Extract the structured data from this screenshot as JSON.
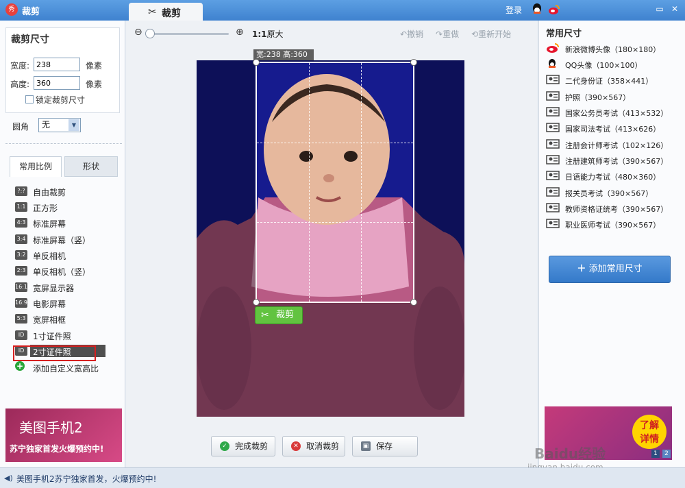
{
  "titlebar": {
    "app_title": "裁剪",
    "tab_label": "裁剪",
    "login": "登录",
    "min": "▭",
    "close": "✕"
  },
  "left": {
    "size_title": "裁剪尺寸",
    "width_label": "宽度:",
    "width_value": "238",
    "height_label": "高度:",
    "height_value": "360",
    "unit": "像素",
    "lock_label": "锁定裁剪尺寸",
    "corner_label": "圆角",
    "corner_value": "无",
    "tabs": [
      "常用比例",
      "形状"
    ],
    "ratios": [
      {
        "badge": "?:?",
        "label": "自由裁剪"
      },
      {
        "badge": "1:1",
        "label": "正方形"
      },
      {
        "badge": "4:3",
        "label": "标准屏幕"
      },
      {
        "badge": "3:4",
        "label": "标准屏幕（竖）"
      },
      {
        "badge": "3:2",
        "label": "单反相机"
      },
      {
        "badge": "2:3",
        "label": "单反相机（竖）"
      },
      {
        "badge": "16:10",
        "label": "宽屏显示器"
      },
      {
        "badge": "16:9",
        "label": "电影屏幕"
      },
      {
        "badge": "5:3",
        "label": "宽屏相框"
      },
      {
        "badge": "ID",
        "label": "1寸证件照"
      },
      {
        "badge": "ID",
        "label": "2寸证件照"
      }
    ],
    "add_ratio": "添加自定义宽高比",
    "ad_title": "美图手机2",
    "ad_sub": "苏宁独家首发火爆预约中!"
  },
  "center": {
    "zoom_ratio": "1:1",
    "zoom_label": "原大",
    "undo": "撤销",
    "redo": "重做",
    "restart": "重新开始",
    "dim_tag": "宽:238 高:360",
    "crop_button": "裁剪",
    "done": "完成裁剪",
    "cancel": "取消裁剪",
    "save": "保存"
  },
  "right": {
    "title": "常用尺寸",
    "presets": [
      {
        "icon": "weibo",
        "label": "新浪微博头像（180×180）"
      },
      {
        "icon": "qq",
        "label": "QQ头像（100×100）"
      },
      {
        "icon": "id",
        "label": "二代身份证（358×441）"
      },
      {
        "icon": "id",
        "label": "护照（390×567）"
      },
      {
        "icon": "id",
        "label": "国家公务员考试（413×532）"
      },
      {
        "icon": "id",
        "label": "国家司法考试（413×626）"
      },
      {
        "icon": "id",
        "label": "注册会计师考试（102×126）"
      },
      {
        "icon": "id",
        "label": "注册建筑师考试（390×567）"
      },
      {
        "icon": "id",
        "label": "日语能力考试（480×360）"
      },
      {
        "icon": "id",
        "label": "报关员考试（390×567）"
      },
      {
        "icon": "id",
        "label": "教师资格证统考（390×567）"
      },
      {
        "icon": "id",
        "label": "职业医师考试（390×567）"
      }
    ],
    "add_size": "添加常用尺寸",
    "ad_badge_1": "了解",
    "ad_badge_2": "详情",
    "pager": [
      "1",
      "2"
    ]
  },
  "status": {
    "text": "美图手机2苏宁独家首发，火爆预约中!"
  },
  "watermark": {
    "line1": "Baidu经验",
    "line2": "jingyan.baidu.com"
  }
}
